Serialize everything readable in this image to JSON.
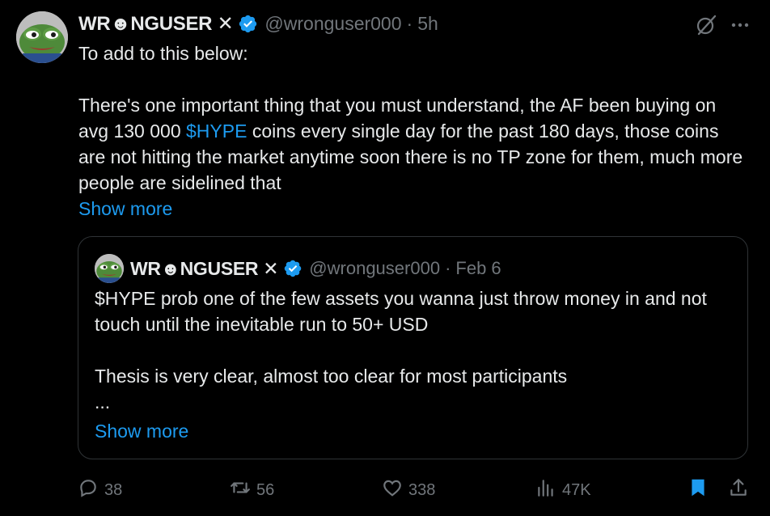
{
  "tweet": {
    "display_name": "WR☻NGUSER ✕",
    "handle": "@wronguser000",
    "separator": "·",
    "time": "5h",
    "text_intro": "To add to this below:\n\nThere's one important thing that you must understand, the AF been buying on avg 130 000 ",
    "cashtag": "$HYPE",
    "text_rest": " coins every single day for the past 180 days, those coins are not hitting the market anytime soon there is no TP zone for them, much more people are sidelined that",
    "show_more": "Show more"
  },
  "quote": {
    "display_name": "WR☻NGUSER ✕",
    "handle": "@wronguser000",
    "separator": "·",
    "time": "Feb 6",
    "text": "$HYPE prob one of the few assets you wanna just throw money in and not touch until the inevitable run to 50+ USD\n\nThesis is very clear, almost too clear for most participants\n...",
    "show_more": "Show more"
  },
  "actions": {
    "replies": "38",
    "reposts": "56",
    "likes": "338",
    "views": "47K"
  },
  "icons": {
    "verified": "verified-badge-icon",
    "grok": "grok-icon",
    "more": "more-icon",
    "reply": "reply-icon",
    "repost": "repost-icon",
    "like": "heart-icon",
    "views": "views-chart-icon",
    "bookmark": "bookmark-icon",
    "share": "share-icon"
  },
  "colors": {
    "background": "#000000",
    "text": "#e7e9ea",
    "muted": "#71767b",
    "accent": "#1d9bf0",
    "border": "#2f3336"
  }
}
